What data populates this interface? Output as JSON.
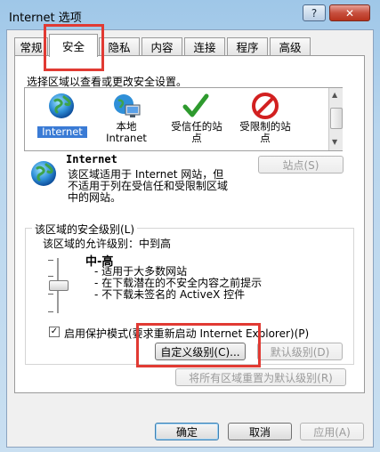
{
  "window": {
    "title": "Internet 选项",
    "help_label": "?",
    "close_label": "✕"
  },
  "tabs": [
    {
      "label": "常规"
    },
    {
      "label": "安全"
    },
    {
      "label": "隐私"
    },
    {
      "label": "内容"
    },
    {
      "label": "连接"
    },
    {
      "label": "程序"
    },
    {
      "label": "高级"
    }
  ],
  "security": {
    "instruction": "选择区域以查看或更改安全设置。",
    "zones": [
      {
        "label": "Internet",
        "icon": "globe-icon"
      },
      {
        "label": "本地\nIntranet",
        "icon": "intranet-icon"
      },
      {
        "label": "受信任的站\n点",
        "icon": "checkmark-icon"
      },
      {
        "label": "受限制的站\n点",
        "icon": "restricted-icon"
      }
    ],
    "selected_zone": "Internet",
    "zone_desc_title": "Internet",
    "zone_desc_text": "该区域适用于 Internet 网站，但\n不适用于列在受信任和受限制区域\n中的网站。",
    "sites_button": "站点(S)",
    "level_group_title": "该区域的安全级别(L)",
    "allowed_levels": "该区域的允许级别：中到高",
    "level_name": "中-高",
    "level_desc": [
      "- 适用于大多数网站",
      "- 在下载潜在的不安全内容之前提示",
      "- 不下载未签名的 ActiveX 控件"
    ],
    "protected_mode_label": "启用保护模式(要求重新启动 Internet Explorer)(P)",
    "protected_mode_checked": true,
    "custom_level_button": "自定义级别(C)...",
    "default_level_button": "默认级别(D)",
    "reset_all_button": "将所有区域重置为默认级别(R)"
  },
  "footer": {
    "ok": "确定",
    "cancel": "取消",
    "apply": "应用(A)"
  }
}
